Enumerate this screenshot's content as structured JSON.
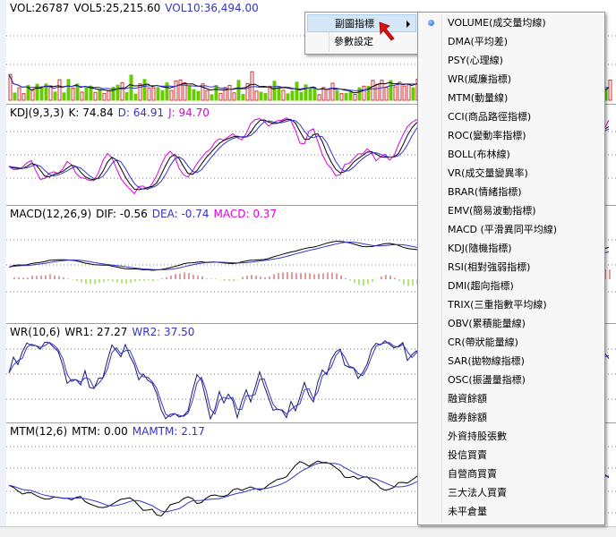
{
  "panels": {
    "volume": {
      "title": "VOL:26787",
      "vol5": "VOL5:25,215.60",
      "vol10": "VOL10:36,494.00"
    },
    "kdj": {
      "title": "KDJ(9,3,3)",
      "k": "K: 74.84",
      "d": "D: 64.91",
      "j": "J: 94.70"
    },
    "macd": {
      "title": "MACD(12,26,9)",
      "dif": "DIF: -0.56",
      "dea": "DEA: -0.74",
      "macd": "MACD: 0.37"
    },
    "wr": {
      "title": "WR(10,6)",
      "wr1": "WR1: 27.27",
      "wr2": "WR2: 37.50"
    },
    "mtm": {
      "title": "MTM(12,6)",
      "mtm": "MTM: 0.00",
      "mamtm": "MAMTM: 2.17"
    }
  },
  "colors": {
    "black": "#000000",
    "blue": "#3333cc",
    "magenta": "#dd00dd",
    "red": "#d03030",
    "green": "#66cc00",
    "navy": "#1a1a6e",
    "grid": "#808080"
  },
  "context_menu": {
    "items": [
      {
        "label": "副圖指標",
        "has_submenu": true,
        "highlighted": true
      },
      {
        "label": "參數設定",
        "has_submenu": false,
        "highlighted": false
      }
    ]
  },
  "submenu": {
    "selected_index": 0,
    "items": [
      "VOLUME(成交量均線)",
      "DMA(平均差)",
      "PSY(心理線)",
      "WR(威廉指標)",
      "MTM(動量線)",
      "CCI(商品路徑指標)",
      "ROC(變動率指標)",
      "BOLL(布林線)",
      "VR(成交量變異率)",
      "BRAR(情緒指標)",
      "EMV(簡易波動指標)",
      "MACD (平滑異同平均線)",
      "KDJ(隨機指標)",
      "RSI(相對強弱指標)",
      "DMI(趨向指標)",
      "TRIX(三重指數平均線)",
      "OBV(累積能量線)",
      "CR(帶狀能量線)",
      "SAR(拋物線指標)",
      "OSC(振盪量指標)",
      "融資餘額",
      "融券餘額",
      "外資持股張數",
      "投信買賣",
      "自營商買賣",
      "三大法人買賣",
      "未平倉量"
    ]
  },
  "icons": {
    "cursor": "red-arrow-cursor-icon",
    "selected": "radio-bullet-icon",
    "submenu_arrow": "triangle-right-icon"
  }
}
